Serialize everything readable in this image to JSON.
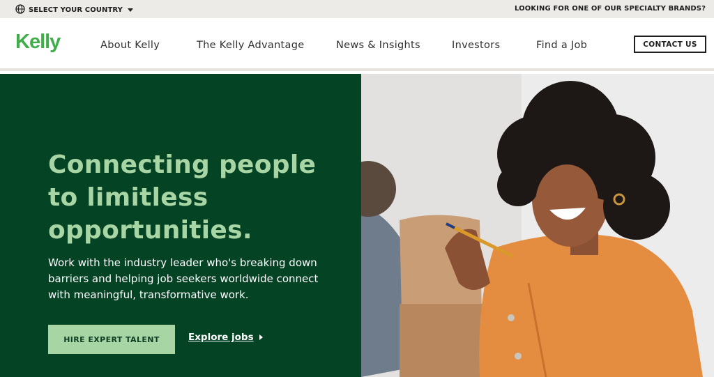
{
  "topbar": {
    "country_label": "SELECT YOUR COUNTRY",
    "brands_label": "LOOKING FOR ONE OF OUR SPECIALTY BRANDS?"
  },
  "header": {
    "logo": "Kelly",
    "nav": [
      "About Kelly",
      "The Kelly Advantage",
      "News & Insights",
      "Investors",
      "Find a Job"
    ],
    "contact_label": "CONTACT US"
  },
  "hero": {
    "headline_lines": [
      "Connecting people",
      "to limitless",
      "opportunities."
    ],
    "subtext": "Work with the industry leader who's breaking down barriers and helping job seekers worldwide connect with meaningful, transformative work.",
    "hire_label": "HIRE EXPERT TALENT",
    "explore_label": "Explore jobs"
  },
  "colors": {
    "brand_green": "#3fae49",
    "hero_dark_green": "#054325",
    "accent_light_green": "#a8d5a4",
    "topbar_bg": "#ecebe8"
  },
  "icons": {
    "globe": "globe-icon",
    "caret": "caret-down-icon",
    "explore_arrow": "triangle-right-icon"
  }
}
